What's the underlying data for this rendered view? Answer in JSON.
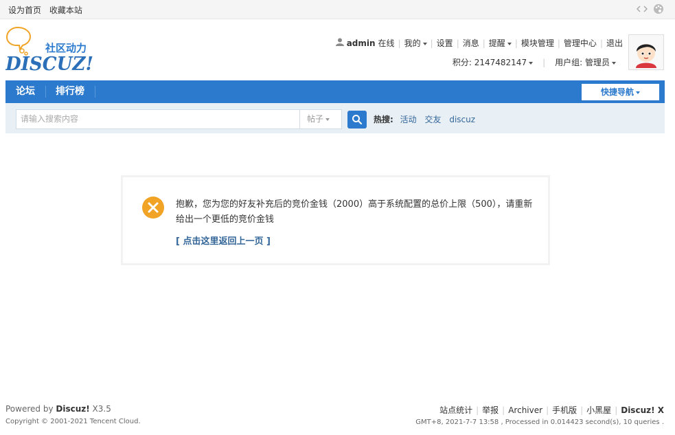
{
  "toolbar": {
    "set_homepage": "设为首页",
    "bookmark": "收藏本站",
    "icons": [
      "code-icon",
      "palette-icon"
    ]
  },
  "header": {
    "logo_text_cn": "社区动力",
    "logo_text_en": "DISCUZ!",
    "user": {
      "username": "admin",
      "status": "在线",
      "my": "我的",
      "settings": "设置",
      "messages": "消息",
      "reminders": "提醒",
      "module_admin": "模块管理",
      "admin_center": "管理中心",
      "logout": "退出",
      "credits": "积分: 2147482147",
      "usergroup": "用户组: 管理员"
    }
  },
  "nav": {
    "items": [
      "论坛",
      "排行榜"
    ],
    "quick_nav": "快捷导航"
  },
  "search": {
    "placeholder": "请输入搜索内容",
    "type": "帖子",
    "hot_label": "热搜:",
    "hot_terms": [
      "活动",
      "交友",
      "discuz"
    ]
  },
  "message": {
    "text": "抱歉，您为您的好友补充后的竞价金钱（2000）高于系统配置的总价上限（500），请重新给出一个更低的竞价金钱",
    "back_link": "[ 点击这里返回上一页 ]"
  },
  "footer": {
    "powered_prefix": "Powered by ",
    "powered_name": "Discuz!",
    "version": " X3.5",
    "copyright": "Copyright © 2001-2021 Tencent Cloud.",
    "links": [
      "站点统计",
      "举报",
      "Archiver",
      "手机版",
      "小黑屋"
    ],
    "brand": "Discuz! X",
    "debug": "GMT+8, 2021-7-7 13:58 , Processed in 0.014423 second(s), 10 queries ."
  },
  "colors": {
    "nav_blue": "#2b7acd",
    "search_bg": "#e8eff5",
    "link": "#336699",
    "error_icon": "#f1a325"
  }
}
